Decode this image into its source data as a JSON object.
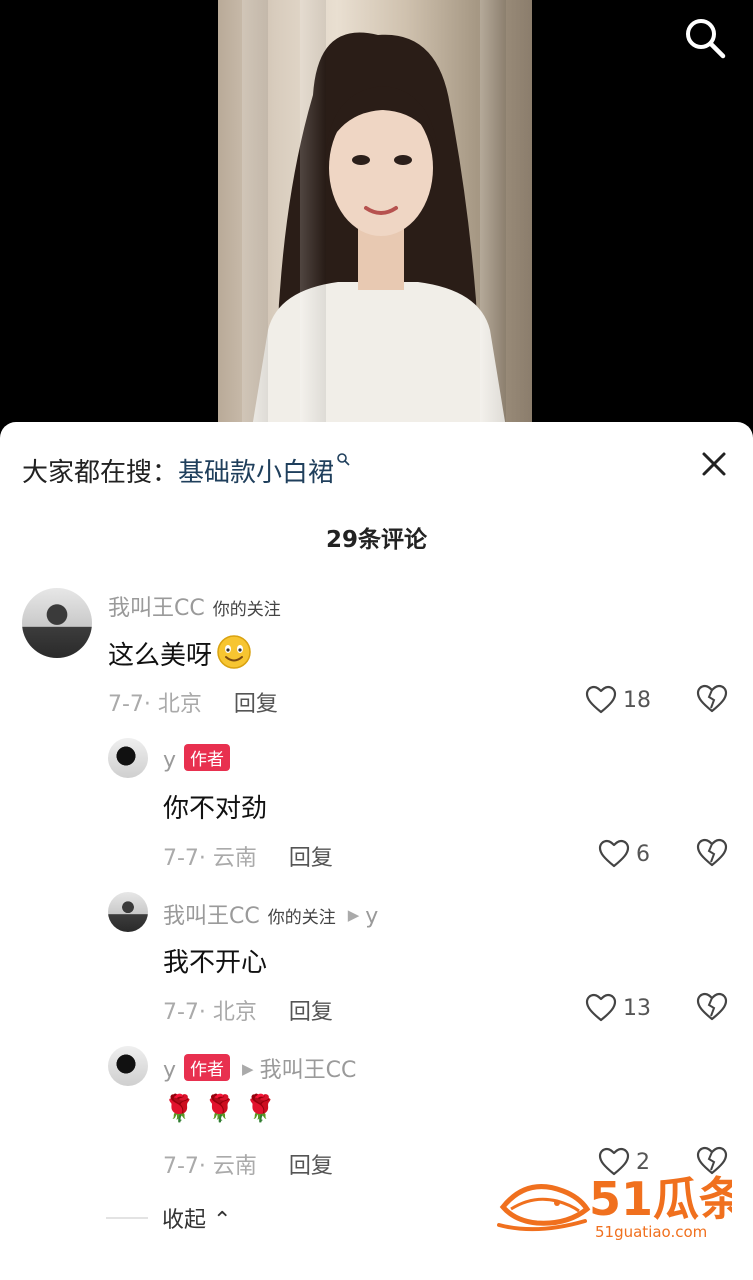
{
  "header": {
    "search_icon": "search-icon"
  },
  "video": {
    "description_visible": false
  },
  "comments_panel": {
    "hot_search_label": "大家都在搜：",
    "hot_search_term": "基础款小白裙",
    "count_title": "29条评论",
    "close_icon": "close-icon",
    "comments": [
      {
        "username": "我叫王CC",
        "tag": "你的关注",
        "text": "这么美呀",
        "date_location": "7-7· 北京",
        "reply_label": "回复",
        "likes": "18"
      },
      {
        "username": "y",
        "author_badge": "作者",
        "text": "你不对劲",
        "date_location": "7-7· 云南",
        "reply_label": "回复",
        "likes": "6"
      },
      {
        "username": "我叫王CC",
        "tag": "你的关注",
        "reply_to": "y",
        "text": "我不开心",
        "date_location": "7-7· 北京",
        "reply_label": "回复",
        "likes": "13"
      },
      {
        "username": "y",
        "author_badge": "作者",
        "reply_to": "我叫王CC",
        "text": "🌹 🌹 🌹",
        "date_location": "7-7· 云南",
        "reply_label": "回复",
        "likes": "2"
      }
    ],
    "collapse_label": "收起"
  },
  "watermark": {
    "brand": "51瓜条",
    "url": "51guatiao.com"
  },
  "colors": {
    "author_badge": "#e8304f",
    "hot_term": "#1f3f5c",
    "watermark_orange": "#f0701e"
  }
}
